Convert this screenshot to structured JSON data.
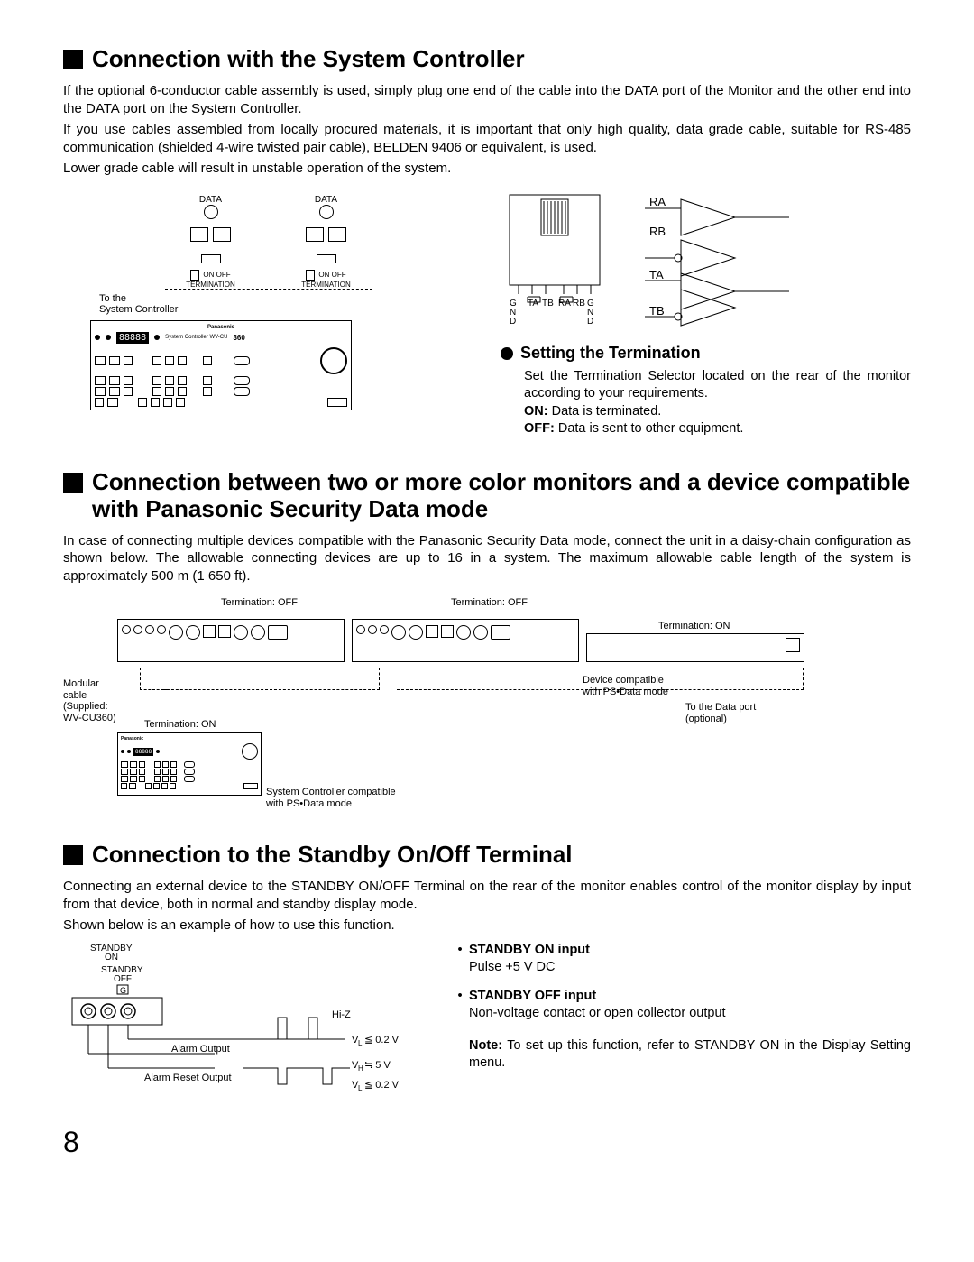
{
  "section1": {
    "heading": "Connection with the System Controller",
    "p1": "If the optional 6-conductor cable assembly is used, simply plug one end of the cable into the DATA port of the Monitor and the other end into the DATA port on the System Controller.",
    "p2": "If you use cables assembled from locally procured materials, it is important that only high quality, data grade cable, suitable for RS-485 communication (shielded 4-wire twisted pair cable), BELDEN 9406 or equivalent, is used.",
    "p3": "Lower grade cable will result in unstable operation of the system.",
    "diagram": {
      "data": "DATA",
      "on_off": "ON OFF",
      "termination": "TERMINATION",
      "to_the": "To the",
      "system_controller": "System Controller",
      "panasonic": "Panasonic",
      "controller_label": "System Controller WV-CU",
      "controller_num": "360",
      "digits": "88888",
      "gnd": "G\nN\nD",
      "ta": "TA",
      "tb": "TB",
      "ra": "RA",
      "rb": "RB"
    },
    "setting_h": "Setting the Termination",
    "setting_body": "Set the Termination Selector located on the rear of the monitor according to your requirements.",
    "on_label": "ON:",
    "on_text": " Data is terminated.",
    "off_label": "OFF:",
    "off_text": " Data is sent to other equipment."
  },
  "section2": {
    "heading": "Connection between two or more color monitors and a device compatible with Panasonic Security Data mode",
    "p1": "In case of connecting multiple devices compatible with the Panasonic Security Data mode, connect the unit in a daisy-chain configuration as shown below. The allowable connecting devices are up to 16 in a system. The maximum allowable cable length of the system is approximately 500 m (1 650 ft).",
    "labels": {
      "term_off": "Termination: OFF",
      "term_on": "Termination: ON",
      "modular_cable": "Modular\ncable\n(Supplied:\nWV-CU360)",
      "device_compat": "Device compatible\nwith PS•Data mode",
      "to_data_port": "To the Data port\n(optional)",
      "sys_compat": "System Controller compatible\nwith PS•Data mode"
    }
  },
  "section3": {
    "heading": "Connection to the Standby On/Off Terminal",
    "p1": "Connecting an external device to the STANDBY ON/OFF Terminal on the rear of the monitor enables control of the monitor display by input from that device, both in normal and standby display mode.",
    "p2": "Shown below is an example of how to use this function.",
    "labels": {
      "standby_on": "STANDBY\nON",
      "standby_off": "STANDBY\nOFF",
      "g": "G",
      "alarm_output": "Alarm Output",
      "alarm_reset_output": "Alarm Reset Output",
      "hi_z": "Hi-Z",
      "vl": "VL ≦ 0.2 V",
      "vh": "VH ≒ 5 V",
      "vl2": "VL ≦ 0.2 V"
    },
    "right": {
      "on_h": "STANDBY ON input",
      "on_body": "Pulse +5 V DC",
      "off_h": "STANDBY OFF input",
      "off_body": "Non-voltage contact or open collector output",
      "note_label": "Note:",
      "note_body": " To set up this function, refer to STANDBY ON in the Display Setting menu."
    }
  },
  "page_number": "8"
}
